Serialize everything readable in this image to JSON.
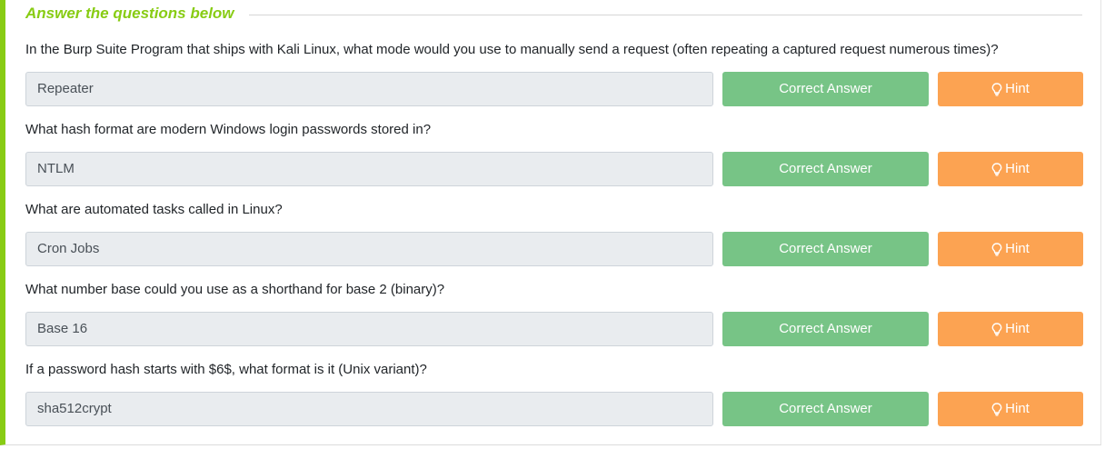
{
  "section_title": "Answer the questions below",
  "correct_label": "Correct Answer",
  "hint_label": "Hint",
  "hint_icon": "lightbulb-icon",
  "colors": {
    "accent": "#88cc14",
    "correct_button": "#77c486",
    "hint_button": "#fca352",
    "field_bg": "#e9ecef"
  },
  "questions": [
    {
      "text": "In the Burp Suite Program that ships with Kali Linux, what mode would you use to manually send a request (often repeating a captured request numerous times)?",
      "answer": "Repeater"
    },
    {
      "text": "What hash format are modern Windows login passwords stored in?",
      "answer": "NTLM"
    },
    {
      "text": "What are automated tasks called in Linux?",
      "answer": "Cron Jobs"
    },
    {
      "text": "What number base could you use as a shorthand for base 2 (binary)?",
      "answer": "Base 16"
    },
    {
      "text": "If a password hash starts with $6$, what format is it (Unix variant)?",
      "answer": "sha512crypt"
    }
  ]
}
